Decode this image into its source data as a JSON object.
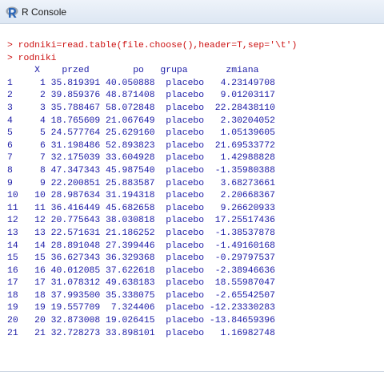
{
  "window": {
    "title": "R Console"
  },
  "console": {
    "commands": [
      "> rodniki=read.table(file.choose(),header=T,sep='\\t')",
      "> rodniki"
    ],
    "header_line": "     X    przed        po   grupa       zmiana",
    "rows": [
      "1     1 35.819391 40.050888  placebo   4.23149708",
      "2     2 39.859376 48.871408  placebo   9.01203117",
      "3     3 35.788467 58.072848  placebo  22.28438110",
      "4     4 18.765609 21.067649  placebo   2.30204052",
      "5     5 24.577764 25.629160  placebo   1.05139605",
      "6     6 31.198486 52.893823  placebo  21.69533772",
      "7     7 32.175039 33.604928  placebo   1.42988828",
      "8     8 47.347343 45.987540  placebo  -1.35980388",
      "9     9 22.200851 25.883587  placebo   3.68273661",
      "10   10 28.987634 31.194318  placebo   2.20668367",
      "11   11 36.416449 45.682658  placebo   9.26620933",
      "12   12 20.775643 38.030818  placebo  17.25517436",
      "13   13 22.571631 21.186252  placebo  -1.38537878",
      "14   14 28.891048 27.399446  placebo  -1.49160168",
      "15   15 36.627343 36.329368  placebo  -0.29797537",
      "16   16 40.012085 37.622618  placebo  -2.38946636",
      "17   17 31.078312 49.638183  placebo  18.55987047",
      "18   18 37.993500 35.338075  placebo  -2.65542507",
      "19   19 19.557709  7.324406  placebo -12.23330283",
      "20   20 32.873008 19.026415  placebo -13.84659396",
      "21   21 32.728273 33.898101  placebo   1.16982748"
    ]
  },
  "colors": {
    "command": "#cc1111",
    "output": "#1a1aa6"
  },
  "icons": {
    "app": "r-logo-icon"
  }
}
